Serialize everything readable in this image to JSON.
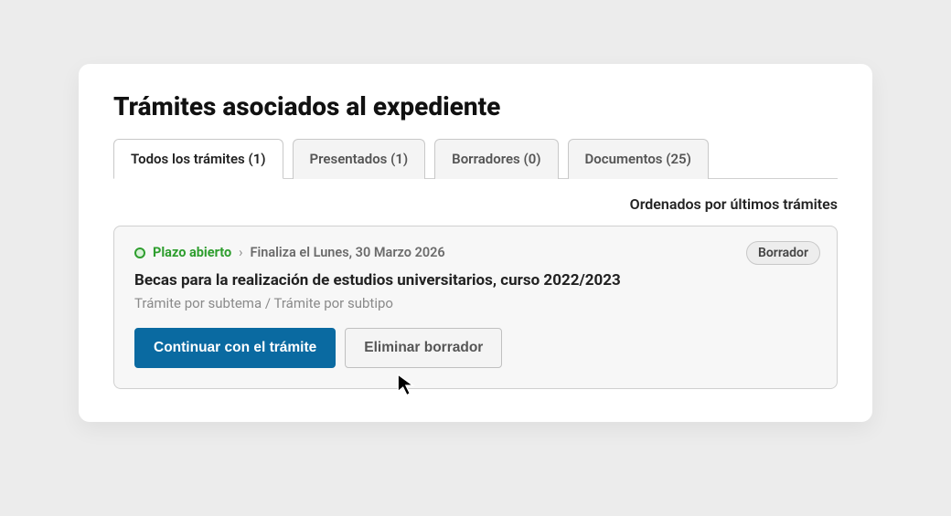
{
  "header": {
    "title": "Trámites asociados al expediente"
  },
  "tabs": [
    {
      "label": "Todos los trámites (1)",
      "active": true
    },
    {
      "label": "Presentados (1)",
      "active": false
    },
    {
      "label": "Borradores (0)",
      "active": false
    },
    {
      "label": "Documentos (25)",
      "active": false
    }
  ],
  "sortLabel": "Ordenados por últimos trámites",
  "item": {
    "statusLabel": "Plazo abierto",
    "chevron": "›",
    "endsLabel": "Finaliza el Lunes, 30 Marzo 2026",
    "badge": "Borrador",
    "title": "Becas para la realización de estudios universitarios, curso 2022/2023",
    "subtheme": "Trámite por subtema",
    "separator": " / ",
    "subtype": "Trámite por subtipo",
    "primaryAction": "Continuar con el trámite",
    "secondaryAction": "Eliminar borrador"
  }
}
